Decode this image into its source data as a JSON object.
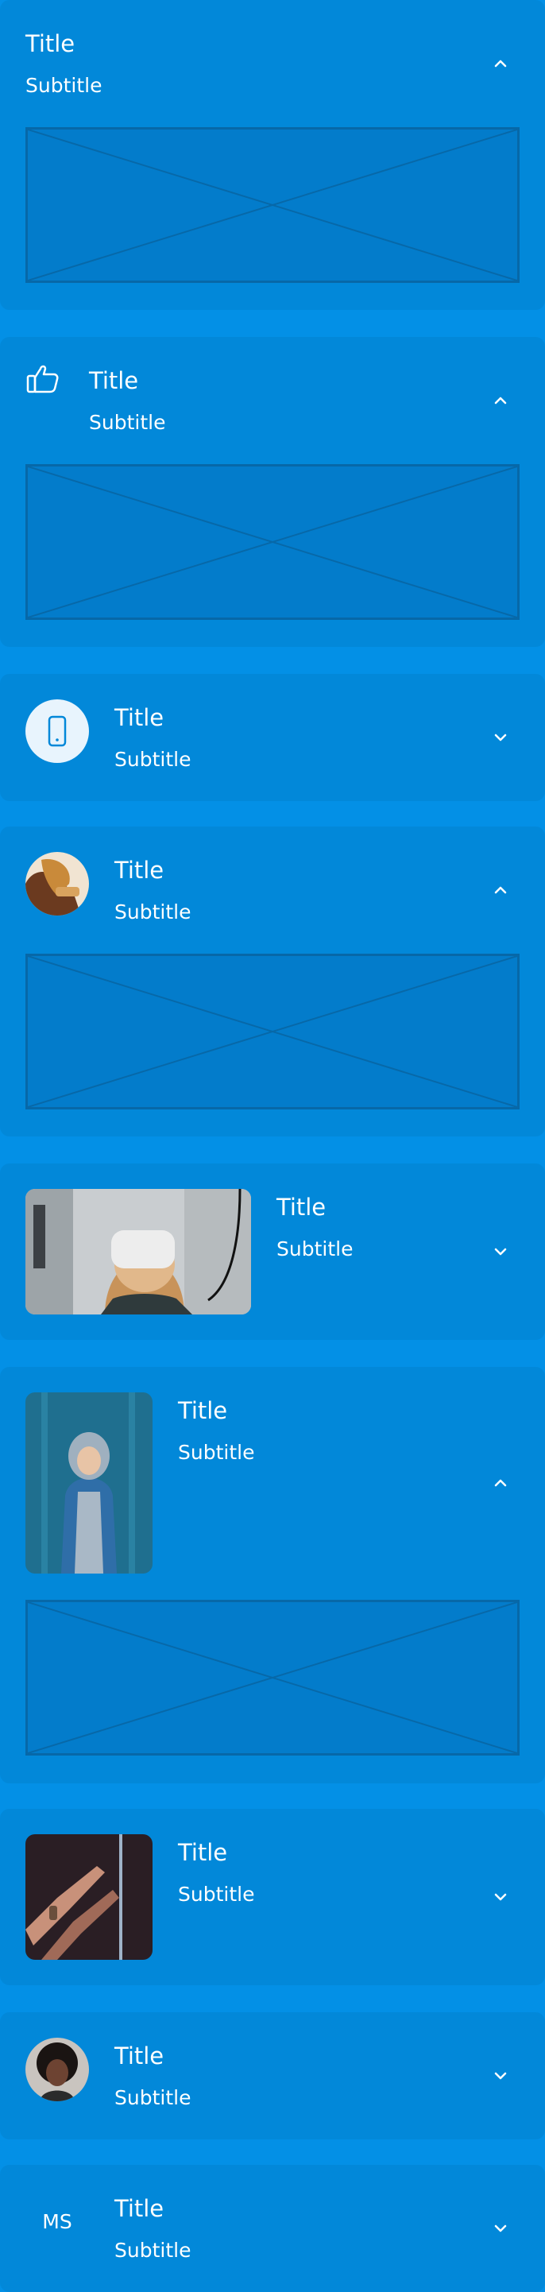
{
  "cards": [
    {
      "title": "Title",
      "subtitle": "Subtitle",
      "expanded": true
    },
    {
      "title": "Title",
      "subtitle": "Subtitle",
      "expanded": true,
      "leading": "thumbs-up-icon"
    },
    {
      "title": "Title",
      "subtitle": "Subtitle",
      "expanded": false,
      "leading": "smartphone-icon"
    },
    {
      "title": "Title",
      "subtitle": "Subtitle",
      "expanded": true,
      "leading": "avatar-photo"
    },
    {
      "title": "Title",
      "subtitle": "Subtitle",
      "expanded": false,
      "leading": "vr-headset-photo"
    },
    {
      "title": "Title",
      "subtitle": "Subtitle",
      "expanded": true,
      "leading": "person-hoodie-photo"
    },
    {
      "title": "Title",
      "subtitle": "Subtitle",
      "expanded": false,
      "leading": "hands-photo"
    },
    {
      "title": "Title",
      "subtitle": "Subtitle",
      "expanded": false,
      "leading": "avatar-portrait"
    },
    {
      "title": "Title",
      "subtitle": "Subtitle",
      "expanded": false,
      "leading": "initials",
      "initials": "MS"
    }
  ],
  "colors": {
    "background": "#0390e6",
    "card": "#0288d9",
    "placeholder_border": "#0768a8",
    "text": "#ffffff"
  }
}
